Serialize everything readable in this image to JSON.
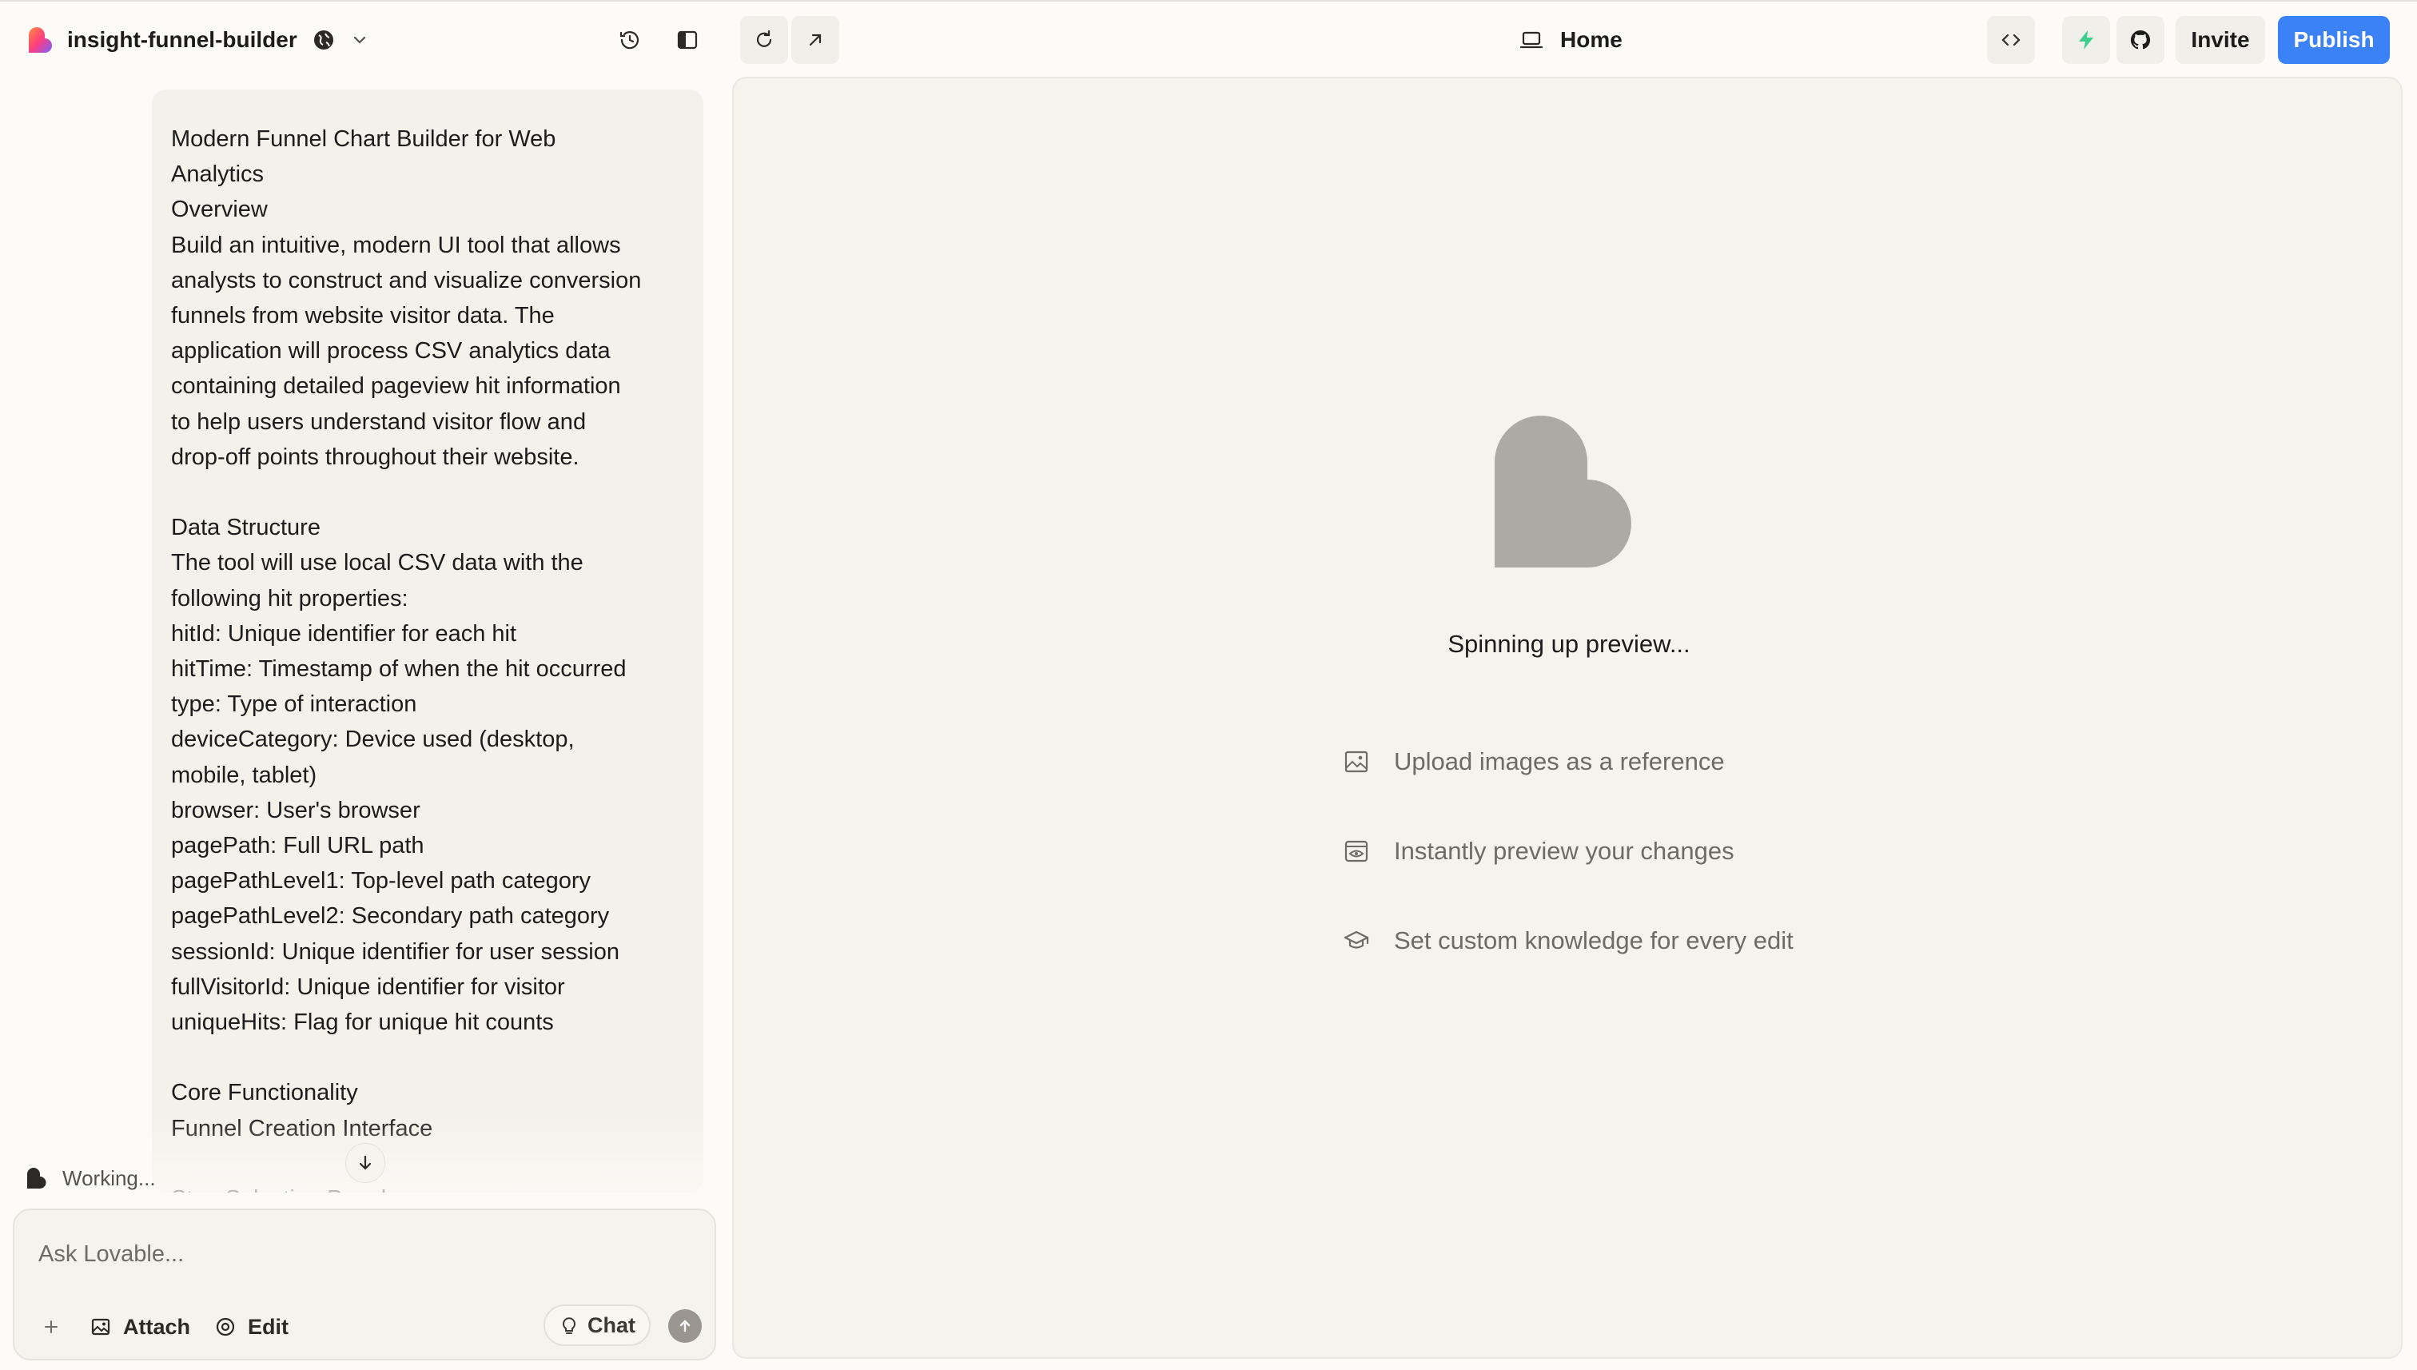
{
  "header": {
    "project_name": "insight-funnel-builder",
    "page_title": "Home",
    "invite_label": "Invite",
    "publish_label": "Publish"
  },
  "chat": {
    "message_lines": [
      "Modern Funnel Chart Builder for Web",
      "Analytics",
      "Overview",
      "Build an intuitive, modern UI tool that allows",
      "analysts to construct and visualize conversion",
      "funnels from website visitor data. The",
      "application will process CSV analytics data",
      "containing detailed pageview hit information",
      "to help users understand visitor flow and",
      "drop-off points throughout their website.",
      "",
      "Data Structure",
      "The tool will use local CSV data with the",
      "following hit properties:",
      "hitId: Unique identifier for each hit",
      "hitTime: Timestamp of when the hit occurred",
      "type: Type of interaction",
      "deviceCategory: Device used (desktop,",
      "mobile, tablet)",
      "browser: User's browser",
      "pagePath: Full URL path",
      "pagePathLevel1: Top-level path category",
      "pagePathLevel2: Secondary path category",
      "sessionId: Unique identifier for user session",
      "fullVisitorId: Unique identifier for visitor",
      "uniqueHits: Flag for unique hit counts",
      "",
      "Core Functionality",
      "Funnel Creation Interface",
      "",
      "Step Selection Panel:"
    ],
    "working_label": "Working...",
    "composer": {
      "placeholder": "Ask Lovable...",
      "attach_label": "Attach",
      "edit_label": "Edit",
      "chat_label": "Chat"
    }
  },
  "preview": {
    "status": "Spinning up preview...",
    "tips": [
      {
        "icon": "image-icon",
        "label": "Upload images as a reference"
      },
      {
        "icon": "eye-icon",
        "label": "Instantly preview your changes"
      },
      {
        "icon": "graduation-cap-icon",
        "label": "Set custom knowledge for every edit"
      }
    ]
  },
  "colors": {
    "accent": "#3b82f6",
    "background": "#fcfbf8",
    "panel": "#f6f3ed",
    "supabase_green": "#3ecf8e",
    "placeholder_logo": "#adaaa4"
  }
}
